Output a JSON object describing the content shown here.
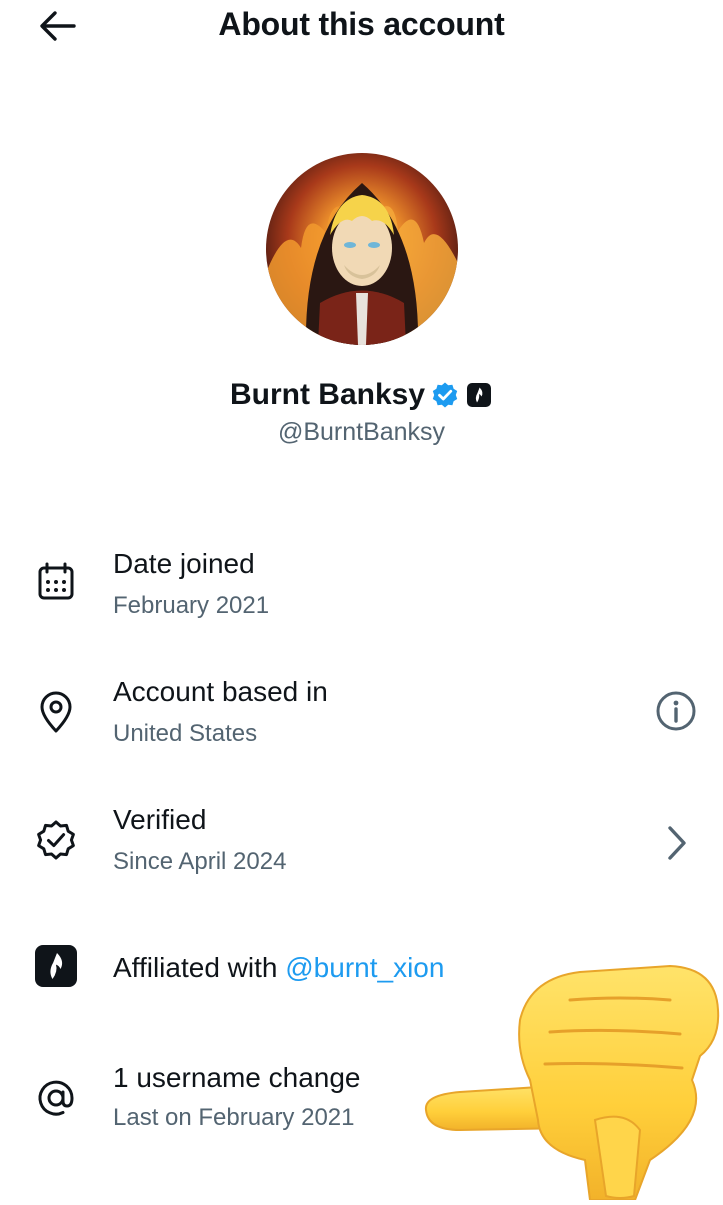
{
  "header": {
    "title": "About this account",
    "back_icon": "arrow-left-icon"
  },
  "profile": {
    "display_name": "Burnt Banksy",
    "handle": "@BurntBanksy",
    "verified_badge_color": "#1d9bf0",
    "affiliate_badge_color": "#0f1419"
  },
  "rows": [
    {
      "icon": "calendar-icon",
      "title": "Date joined",
      "subtitle": "February 2021"
    },
    {
      "icon": "location-pin-icon",
      "title": "Account based in",
      "subtitle": "United States",
      "action_icon": "info-icon"
    },
    {
      "icon": "verified-badge-outline-icon",
      "title": "Verified",
      "subtitle": "Since April 2024",
      "action_icon": "chevron-right-icon"
    },
    {
      "icon": "affiliate-logo-icon",
      "title_prefix": "Affiliated with ",
      "title_link": "@burnt_xion"
    },
    {
      "icon": "at-sign-icon",
      "title": "1 username change",
      "subtitle": "Last on February 2021"
    }
  ],
  "colors": {
    "text_primary": "#0f1419",
    "text_secondary": "#536471",
    "link": "#1d9bf0"
  },
  "overlay": {
    "emoji": "thumbs-down-hand-emoji"
  }
}
